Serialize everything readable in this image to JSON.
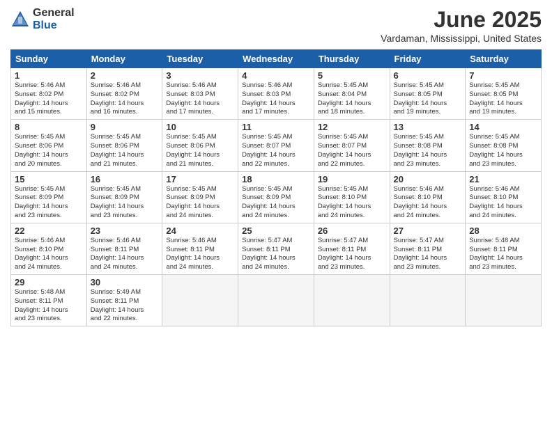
{
  "logo": {
    "general": "General",
    "blue": "Blue"
  },
  "title": "June 2025",
  "location": "Vardaman, Mississippi, United States",
  "headers": [
    "Sunday",
    "Monday",
    "Tuesday",
    "Wednesday",
    "Thursday",
    "Friday",
    "Saturday"
  ],
  "weeks": [
    [
      {
        "num": "1",
        "lines": [
          "Sunrise: 5:46 AM",
          "Sunset: 8:02 PM",
          "Daylight: 14 hours",
          "and 15 minutes."
        ]
      },
      {
        "num": "2",
        "lines": [
          "Sunrise: 5:46 AM",
          "Sunset: 8:02 PM",
          "Daylight: 14 hours",
          "and 16 minutes."
        ]
      },
      {
        "num": "3",
        "lines": [
          "Sunrise: 5:46 AM",
          "Sunset: 8:03 PM",
          "Daylight: 14 hours",
          "and 17 minutes."
        ]
      },
      {
        "num": "4",
        "lines": [
          "Sunrise: 5:46 AM",
          "Sunset: 8:03 PM",
          "Daylight: 14 hours",
          "and 17 minutes."
        ]
      },
      {
        "num": "5",
        "lines": [
          "Sunrise: 5:45 AM",
          "Sunset: 8:04 PM",
          "Daylight: 14 hours",
          "and 18 minutes."
        ]
      },
      {
        "num": "6",
        "lines": [
          "Sunrise: 5:45 AM",
          "Sunset: 8:05 PM",
          "Daylight: 14 hours",
          "and 19 minutes."
        ]
      },
      {
        "num": "7",
        "lines": [
          "Sunrise: 5:45 AM",
          "Sunset: 8:05 PM",
          "Daylight: 14 hours",
          "and 19 minutes."
        ]
      }
    ],
    [
      {
        "num": "8",
        "lines": [
          "Sunrise: 5:45 AM",
          "Sunset: 8:06 PM",
          "Daylight: 14 hours",
          "and 20 minutes."
        ]
      },
      {
        "num": "9",
        "lines": [
          "Sunrise: 5:45 AM",
          "Sunset: 8:06 PM",
          "Daylight: 14 hours",
          "and 21 minutes."
        ]
      },
      {
        "num": "10",
        "lines": [
          "Sunrise: 5:45 AM",
          "Sunset: 8:06 PM",
          "Daylight: 14 hours",
          "and 21 minutes."
        ]
      },
      {
        "num": "11",
        "lines": [
          "Sunrise: 5:45 AM",
          "Sunset: 8:07 PM",
          "Daylight: 14 hours",
          "and 22 minutes."
        ]
      },
      {
        "num": "12",
        "lines": [
          "Sunrise: 5:45 AM",
          "Sunset: 8:07 PM",
          "Daylight: 14 hours",
          "and 22 minutes."
        ]
      },
      {
        "num": "13",
        "lines": [
          "Sunrise: 5:45 AM",
          "Sunset: 8:08 PM",
          "Daylight: 14 hours",
          "and 23 minutes."
        ]
      },
      {
        "num": "14",
        "lines": [
          "Sunrise: 5:45 AM",
          "Sunset: 8:08 PM",
          "Daylight: 14 hours",
          "and 23 minutes."
        ]
      }
    ],
    [
      {
        "num": "15",
        "lines": [
          "Sunrise: 5:45 AM",
          "Sunset: 8:09 PM",
          "Daylight: 14 hours",
          "and 23 minutes."
        ]
      },
      {
        "num": "16",
        "lines": [
          "Sunrise: 5:45 AM",
          "Sunset: 8:09 PM",
          "Daylight: 14 hours",
          "and 23 minutes."
        ]
      },
      {
        "num": "17",
        "lines": [
          "Sunrise: 5:45 AM",
          "Sunset: 8:09 PM",
          "Daylight: 14 hours",
          "and 24 minutes."
        ]
      },
      {
        "num": "18",
        "lines": [
          "Sunrise: 5:45 AM",
          "Sunset: 8:09 PM",
          "Daylight: 14 hours",
          "and 24 minutes."
        ]
      },
      {
        "num": "19",
        "lines": [
          "Sunrise: 5:45 AM",
          "Sunset: 8:10 PM",
          "Daylight: 14 hours",
          "and 24 minutes."
        ]
      },
      {
        "num": "20",
        "lines": [
          "Sunrise: 5:46 AM",
          "Sunset: 8:10 PM",
          "Daylight: 14 hours",
          "and 24 minutes."
        ]
      },
      {
        "num": "21",
        "lines": [
          "Sunrise: 5:46 AM",
          "Sunset: 8:10 PM",
          "Daylight: 14 hours",
          "and 24 minutes."
        ]
      }
    ],
    [
      {
        "num": "22",
        "lines": [
          "Sunrise: 5:46 AM",
          "Sunset: 8:10 PM",
          "Daylight: 14 hours",
          "and 24 minutes."
        ]
      },
      {
        "num": "23",
        "lines": [
          "Sunrise: 5:46 AM",
          "Sunset: 8:11 PM",
          "Daylight: 14 hours",
          "and 24 minutes."
        ]
      },
      {
        "num": "24",
        "lines": [
          "Sunrise: 5:46 AM",
          "Sunset: 8:11 PM",
          "Daylight: 14 hours",
          "and 24 minutes."
        ]
      },
      {
        "num": "25",
        "lines": [
          "Sunrise: 5:47 AM",
          "Sunset: 8:11 PM",
          "Daylight: 14 hours",
          "and 24 minutes."
        ]
      },
      {
        "num": "26",
        "lines": [
          "Sunrise: 5:47 AM",
          "Sunset: 8:11 PM",
          "Daylight: 14 hours",
          "and 23 minutes."
        ]
      },
      {
        "num": "27",
        "lines": [
          "Sunrise: 5:47 AM",
          "Sunset: 8:11 PM",
          "Daylight: 14 hours",
          "and 23 minutes."
        ]
      },
      {
        "num": "28",
        "lines": [
          "Sunrise: 5:48 AM",
          "Sunset: 8:11 PM",
          "Daylight: 14 hours",
          "and 23 minutes."
        ]
      }
    ],
    [
      {
        "num": "29",
        "lines": [
          "Sunrise: 5:48 AM",
          "Sunset: 8:11 PM",
          "Daylight: 14 hours",
          "and 23 minutes."
        ]
      },
      {
        "num": "30",
        "lines": [
          "Sunrise: 5:49 AM",
          "Sunset: 8:11 PM",
          "Daylight: 14 hours",
          "and 22 minutes."
        ]
      },
      {
        "num": "",
        "lines": []
      },
      {
        "num": "",
        "lines": []
      },
      {
        "num": "",
        "lines": []
      },
      {
        "num": "",
        "lines": []
      },
      {
        "num": "",
        "lines": []
      }
    ]
  ]
}
